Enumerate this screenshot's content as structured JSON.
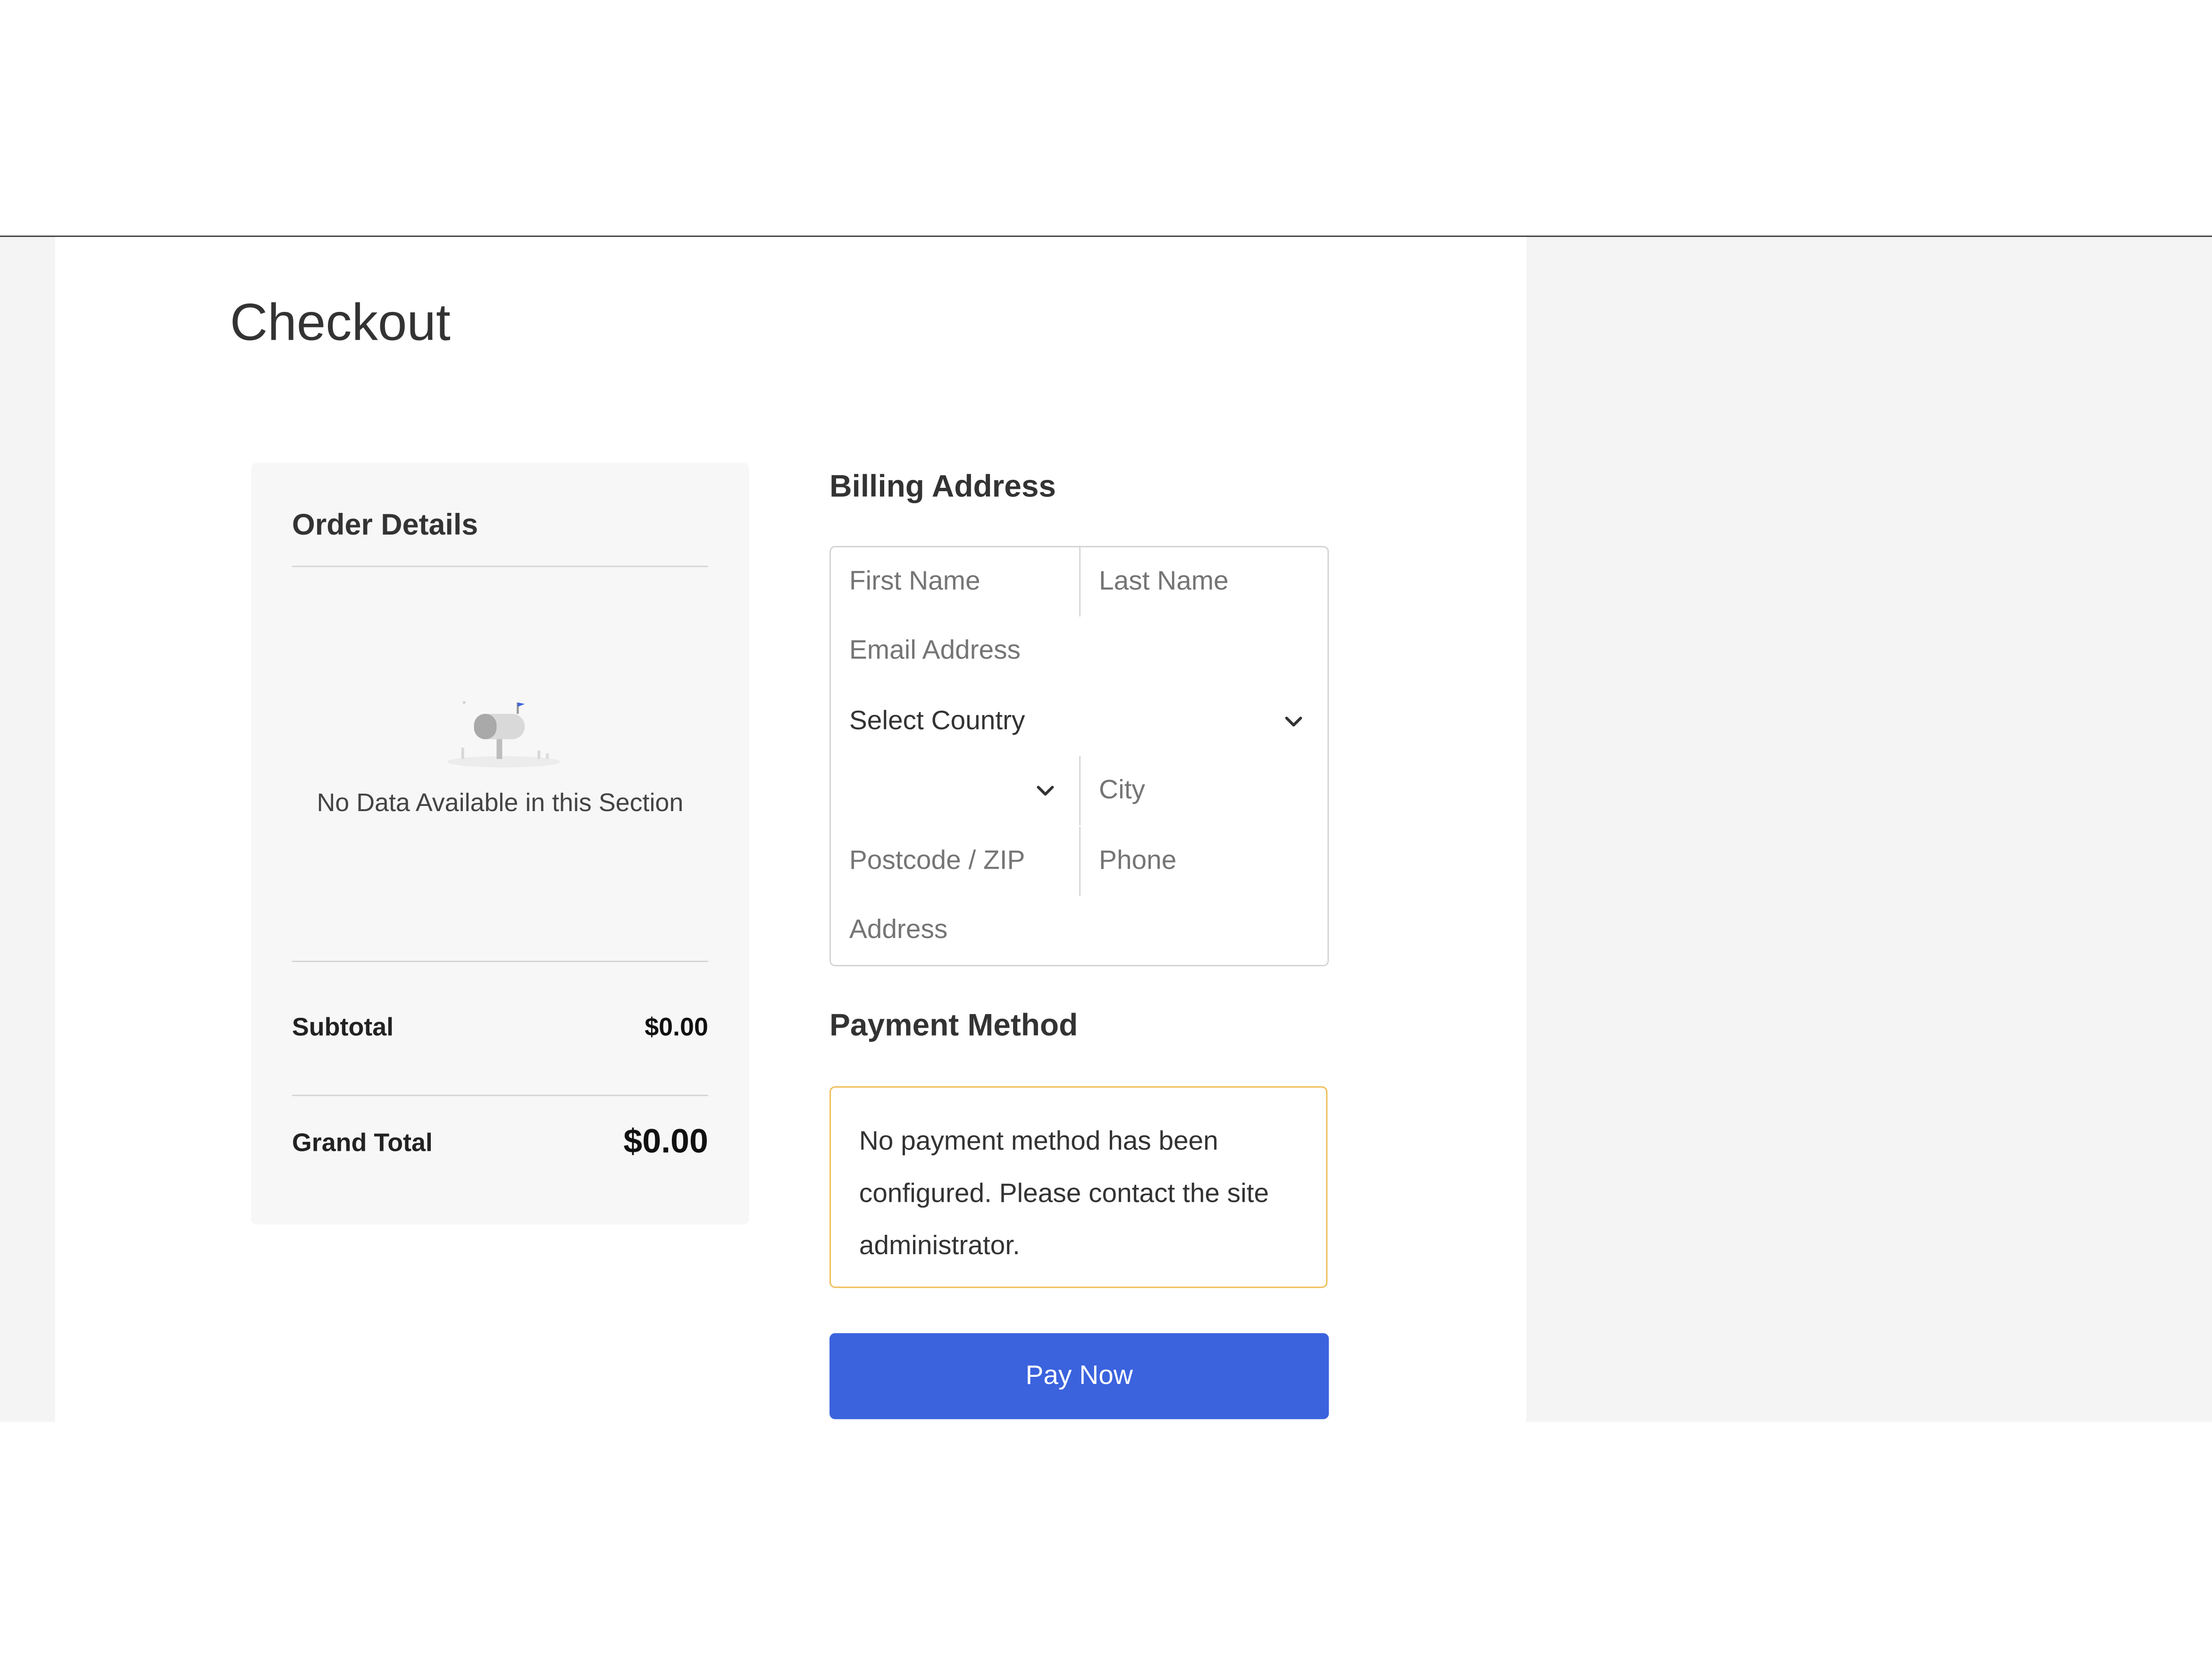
{
  "page": {
    "title": "Checkout"
  },
  "order": {
    "title": "Order Details",
    "empty_message": "No Data Available in this Section",
    "empty_icon": "empty-mailbox-icon",
    "subtotal_label": "Subtotal",
    "subtotal_value": "$0.00",
    "grand_total_label": "Grand Total",
    "grand_total_value": "$0.00"
  },
  "billing": {
    "title": "Billing Address",
    "first_name_placeholder": "First Name",
    "last_name_placeholder": "Last Name",
    "email_placeholder": "Email Address",
    "country_selected": "Select Country",
    "state_selected": "",
    "city_placeholder": "City",
    "postcode_placeholder": "Postcode / ZIP",
    "phone_placeholder": "Phone",
    "address_placeholder": "Address"
  },
  "payment": {
    "title": "Payment Method",
    "notice": "No payment method has been configured. Please contact the site administrator.",
    "notice_border_color": "#efbe5a"
  },
  "actions": {
    "pay_label": "Pay Now",
    "pay_color": "#3b63de"
  }
}
